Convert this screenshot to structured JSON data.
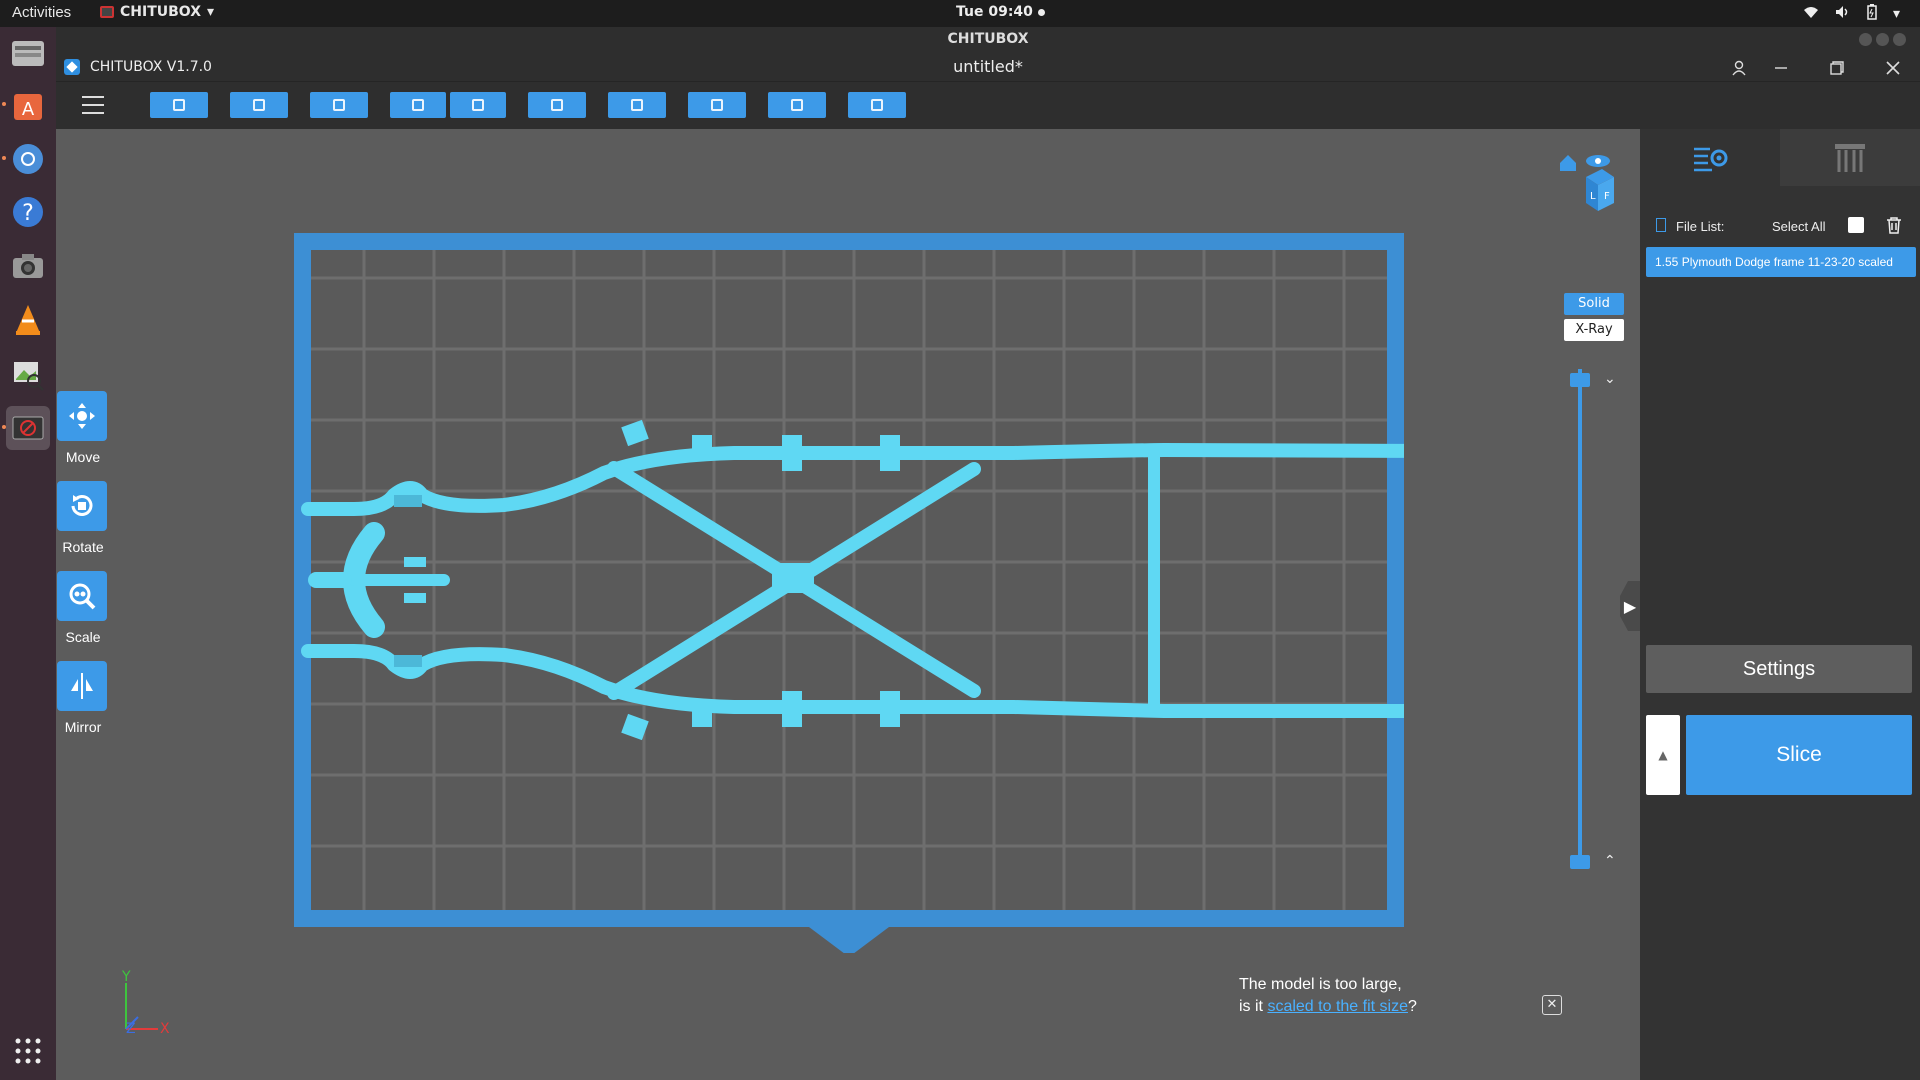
{
  "topbar": {
    "activities": "Activities",
    "app_menu": "CHITUBOX",
    "clock": "Tue 09:40"
  },
  "window": {
    "wm_title": "CHITUBOX",
    "doc_title": "untitled*",
    "app_name": "CHITUBOX V1.7.0"
  },
  "toolbar": {
    "buttons": [
      "open-file",
      "save",
      "auto-layout",
      "undo",
      "redo",
      "copy",
      "hollow",
      "support",
      "dig-hole",
      "repair"
    ]
  },
  "left_tools": [
    {
      "label": "Move",
      "icon": "move-icon"
    },
    {
      "label": "Rotate",
      "icon": "rotate-icon"
    },
    {
      "label": "Scale",
      "icon": "scale-icon"
    },
    {
      "label": "Mirror",
      "icon": "mirror-icon"
    }
  ],
  "view_modes": {
    "solid": "Solid",
    "xray": "X-Ray"
  },
  "axis": {
    "x": "X",
    "y": "Y",
    "z": "Z"
  },
  "notice": {
    "line1": "The model is too large,",
    "line2_prefix": "is it ",
    "link": "scaled to the fit size",
    "line2_suffix": "?"
  },
  "right_panel": {
    "file_list_label": "File List:",
    "select_all": "Select All",
    "file_item": "1.55 Plymouth Dodge frame 11-23-20 scaled",
    "settings": "Settings",
    "slice": "Slice"
  },
  "colors": {
    "accent": "#3d9ae8",
    "model": "#5fd8f3",
    "plate": "#3d8fd4",
    "grid": "#6e6e6e"
  }
}
